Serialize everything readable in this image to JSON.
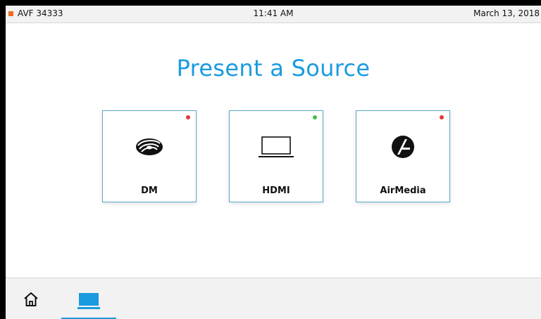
{
  "status": {
    "room": "AVF 34333",
    "time": "11:41 AM",
    "date": "March 13, 2018",
    "room_indicator_color": "#f26a1f"
  },
  "title": "Present a Source",
  "sources": [
    {
      "label": "DM",
      "icon": "crestron-swirl-icon",
      "status": "offline",
      "status_color": "#e53935"
    },
    {
      "label": "HDMI",
      "icon": "laptop-icon",
      "status": "online",
      "status_color": "#43c04a"
    },
    {
      "label": "AirMedia",
      "icon": "airmedia-icon",
      "status": "offline",
      "status_color": "#e53935"
    }
  ],
  "nav": {
    "home_icon": "home-icon",
    "sources_icon": "monitor-icon",
    "active": "sources"
  },
  "colors": {
    "accent": "#1a9be0",
    "tile_border": "#5aa8c8"
  }
}
